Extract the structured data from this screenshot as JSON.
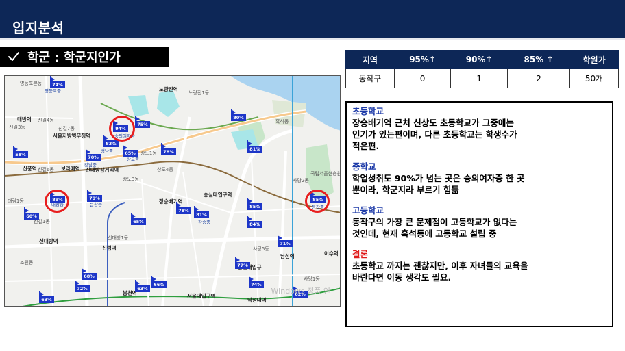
{
  "header": {
    "title": "입지분석"
  },
  "section": {
    "icon": "check-icon",
    "title": "학군 : 학군지인가"
  },
  "table": {
    "headers": [
      "지역",
      "95%↑",
      "90%↑",
      "85% ↑",
      "학원가"
    ],
    "rows": [
      [
        "동작구",
        "0",
        "1",
        "2",
        "50개"
      ]
    ]
  },
  "notes": [
    {
      "heading": "초등학교",
      "text": "장승배기역 근처 신상도 초등학교가 그중에는\n인기가 있는편이며, 다른 초등학교는 학생수가\n적은편.",
      "color": "#1d3aa8"
    },
    {
      "heading": "중학교",
      "text": "학업성취도 90%가 넘는 곳은 숭의여자중 한 곳\n뿐이라, 학군지라 부르기 힘듦",
      "color": "#1d3aa8"
    },
    {
      "heading": "고등학교",
      "text": "동작구의 가장 큰 문제점이 고등학교가 없다는\n것인데, 현재 흑석동에 고등학교 설립 중",
      "color": "#1d3aa8"
    },
    {
      "heading": "결론",
      "text": "초등학교 까지는 괜찮지만, 이후 자녀들의 교육을\n바란다면 이동 생각도 필요.",
      "color": "#e01b1b"
    }
  ],
  "map": {
    "watermark": "Windows 정품 인",
    "pins": [
      {
        "pct": "74%"
      },
      {
        "pct": "94%"
      },
      {
        "pct": "75%"
      },
      {
        "pct": "80%"
      },
      {
        "pct": "81%"
      },
      {
        "pct": "70%"
      },
      {
        "pct": "83%"
      },
      {
        "pct": "65%"
      },
      {
        "pct": "78%"
      },
      {
        "pct": "58%"
      },
      {
        "pct": "89%"
      },
      {
        "pct": "79%"
      },
      {
        "pct": "60%"
      },
      {
        "pct": "78%"
      },
      {
        "pct": "81%"
      },
      {
        "pct": "65%"
      },
      {
        "pct": "85%"
      },
      {
        "pct": "84%"
      },
      {
        "pct": "85%"
      },
      {
        "pct": "71%"
      },
      {
        "pct": "77%"
      },
      {
        "pct": "68%"
      },
      {
        "pct": "72%"
      },
      {
        "pct": "63%"
      },
      {
        "pct": "66%"
      },
      {
        "pct": "74%"
      },
      {
        "pct": "62%"
      },
      {
        "pct": "63%"
      }
    ],
    "schools": [
      "숭의여자중",
      "대방중",
      "동작중",
      "장승중",
      "문창중",
      "상도중",
      "강남중",
      "성남중",
      "영등포중"
    ],
    "places": [
      "영등포본동",
      "노량진역",
      "노량진1동",
      "신길3동",
      "신길7동",
      "신길4동",
      "서울지방병무청역",
      "보라매역",
      "신대방삼거리역",
      "상도1동",
      "상도3동",
      "상도4동",
      "숭실대입구역",
      "장승배기역",
      "신길6동",
      "대림1동",
      "신길1동",
      "신대방1동",
      "신대방역",
      "신풍역",
      "흑석동",
      "사당2동",
      "사당5동",
      "사당1동",
      "남성역",
      "이수역",
      "총신대입구",
      "낙성대역",
      "서울대입구역",
      "봉천역",
      "신림역",
      "조원동",
      "대방역",
      "국립서울현충원"
    ]
  }
}
